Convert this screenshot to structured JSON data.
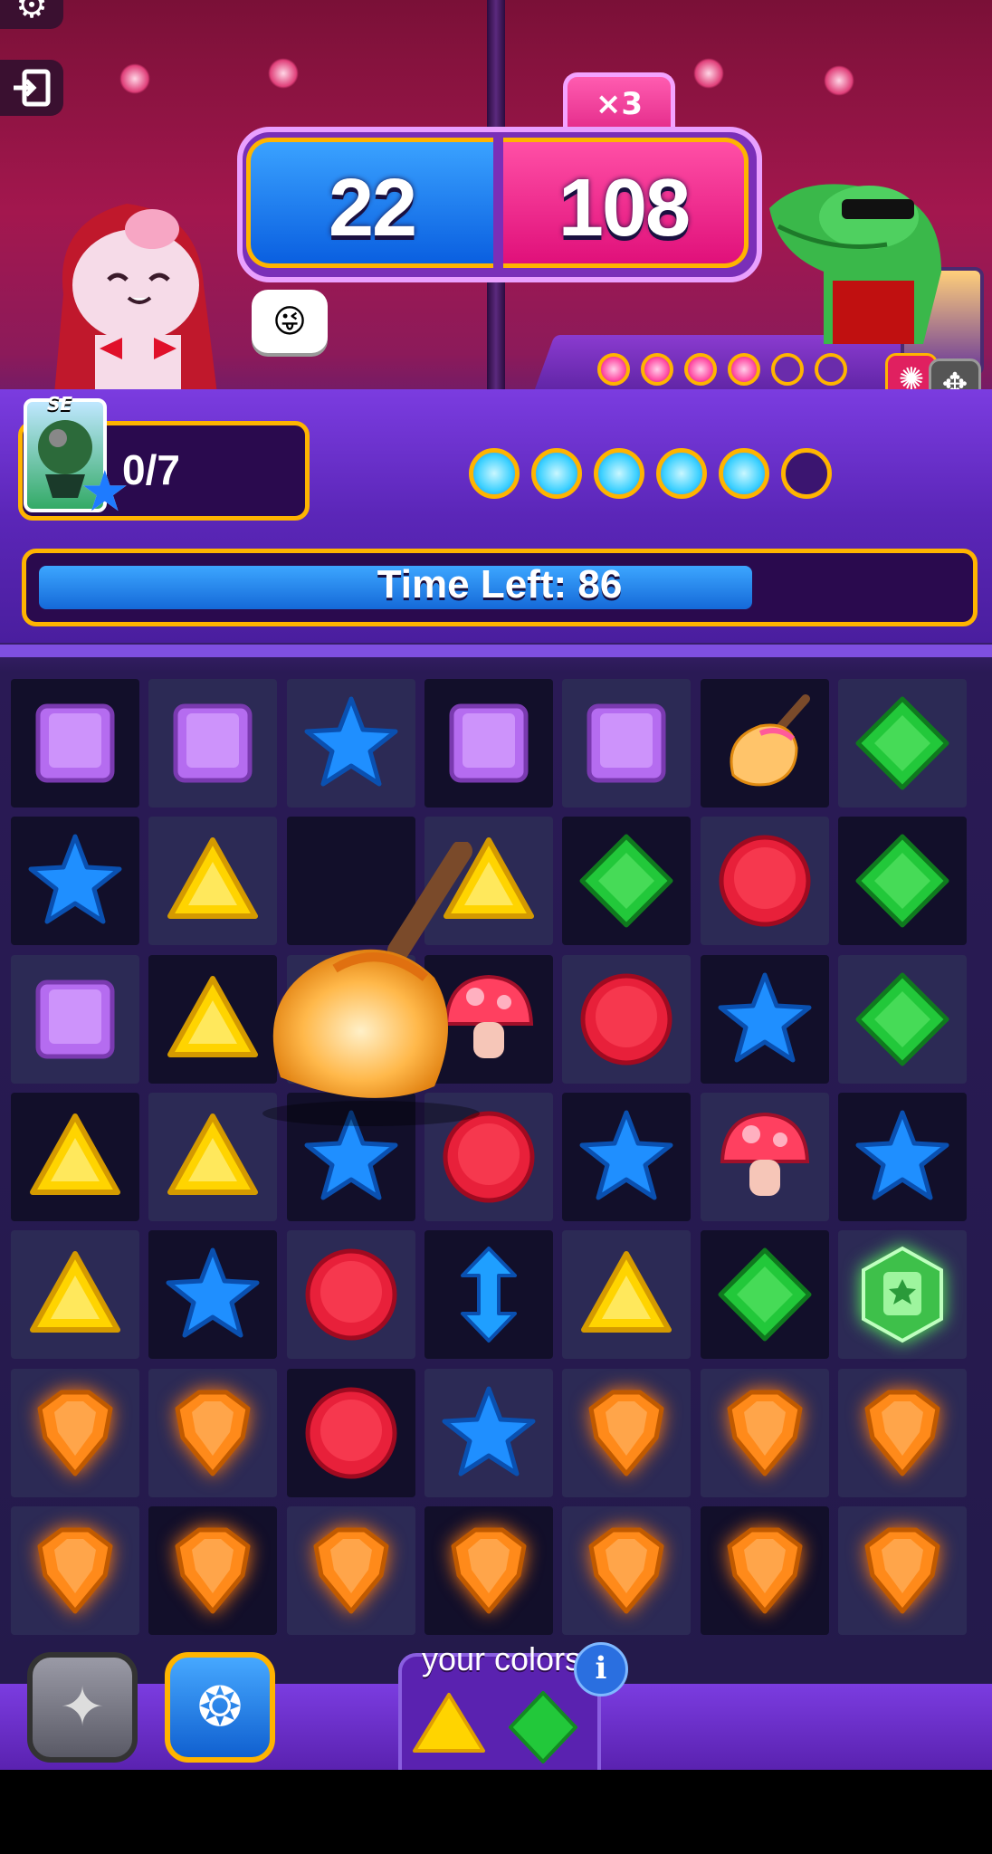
{
  "header": {
    "settings_icon": "gear-icon",
    "exit_icon": "exit-icon"
  },
  "score": {
    "player": "22",
    "opponent": "108",
    "multiplier": "×3"
  },
  "opponent": {
    "ability_dots_filled": 4,
    "ability_dots_total": 6
  },
  "player": {
    "card_label": "SE",
    "progress": "0/7",
    "ability_dots_filled": 5,
    "ability_dots_total": 6
  },
  "timer": {
    "label": "Time Left: 86",
    "fraction_remaining": 0.78
  },
  "board": {
    "rows": [
      [
        "square",
        "square",
        "star",
        "square",
        "square",
        "broom",
        "diamond"
      ],
      [
        "star",
        "triangle",
        "empty",
        "triangle",
        "diamond",
        "circle",
        "diamond"
      ],
      [
        "square",
        "triangle",
        "empty",
        "mushroom",
        "circle",
        "star",
        "diamond"
      ],
      [
        "triangle",
        "triangle",
        "star",
        "circle",
        "star",
        "mushroom",
        "star"
      ],
      [
        "triangle",
        "star",
        "circle",
        "arrow",
        "triangle",
        "diamond",
        "badge"
      ],
      [
        "shield",
        "shield",
        "circle",
        "star",
        "shield",
        "shield",
        "shield"
      ],
      [
        "shield",
        "shield",
        "shield",
        "shield",
        "shield",
        "shield",
        "shield"
      ]
    ],
    "dark_cells": [
      [
        1,
        0,
        0,
        1,
        0,
        1,
        0
      ],
      [
        1,
        0,
        1,
        0,
        1,
        0,
        1
      ],
      [
        0,
        1,
        0,
        1,
        0,
        1,
        0
      ],
      [
        1,
        0,
        1,
        0,
        1,
        0,
        1
      ],
      [
        0,
        1,
        0,
        1,
        0,
        1,
        0
      ],
      [
        0,
        0,
        1,
        0,
        0,
        0,
        0
      ],
      [
        0,
        1,
        0,
        1,
        0,
        1,
        0
      ]
    ]
  },
  "colors": {
    "label": "your colors",
    "info": "i",
    "items": [
      "triangle",
      "diamond"
    ]
  },
  "tools": {
    "left_icon": "sparkle-star-icon",
    "right_icon": "scarab-icon"
  },
  "palette": {
    "square": "#b56cf0",
    "star": "#1f8fff",
    "triangle": "#ffd400",
    "diamond": "#22c83a",
    "circle": "#e8203a",
    "mushroom": "#ff4060",
    "shield": "#ff8a1a",
    "badge": "#3ec04a",
    "arrow": "#1f9fff"
  }
}
